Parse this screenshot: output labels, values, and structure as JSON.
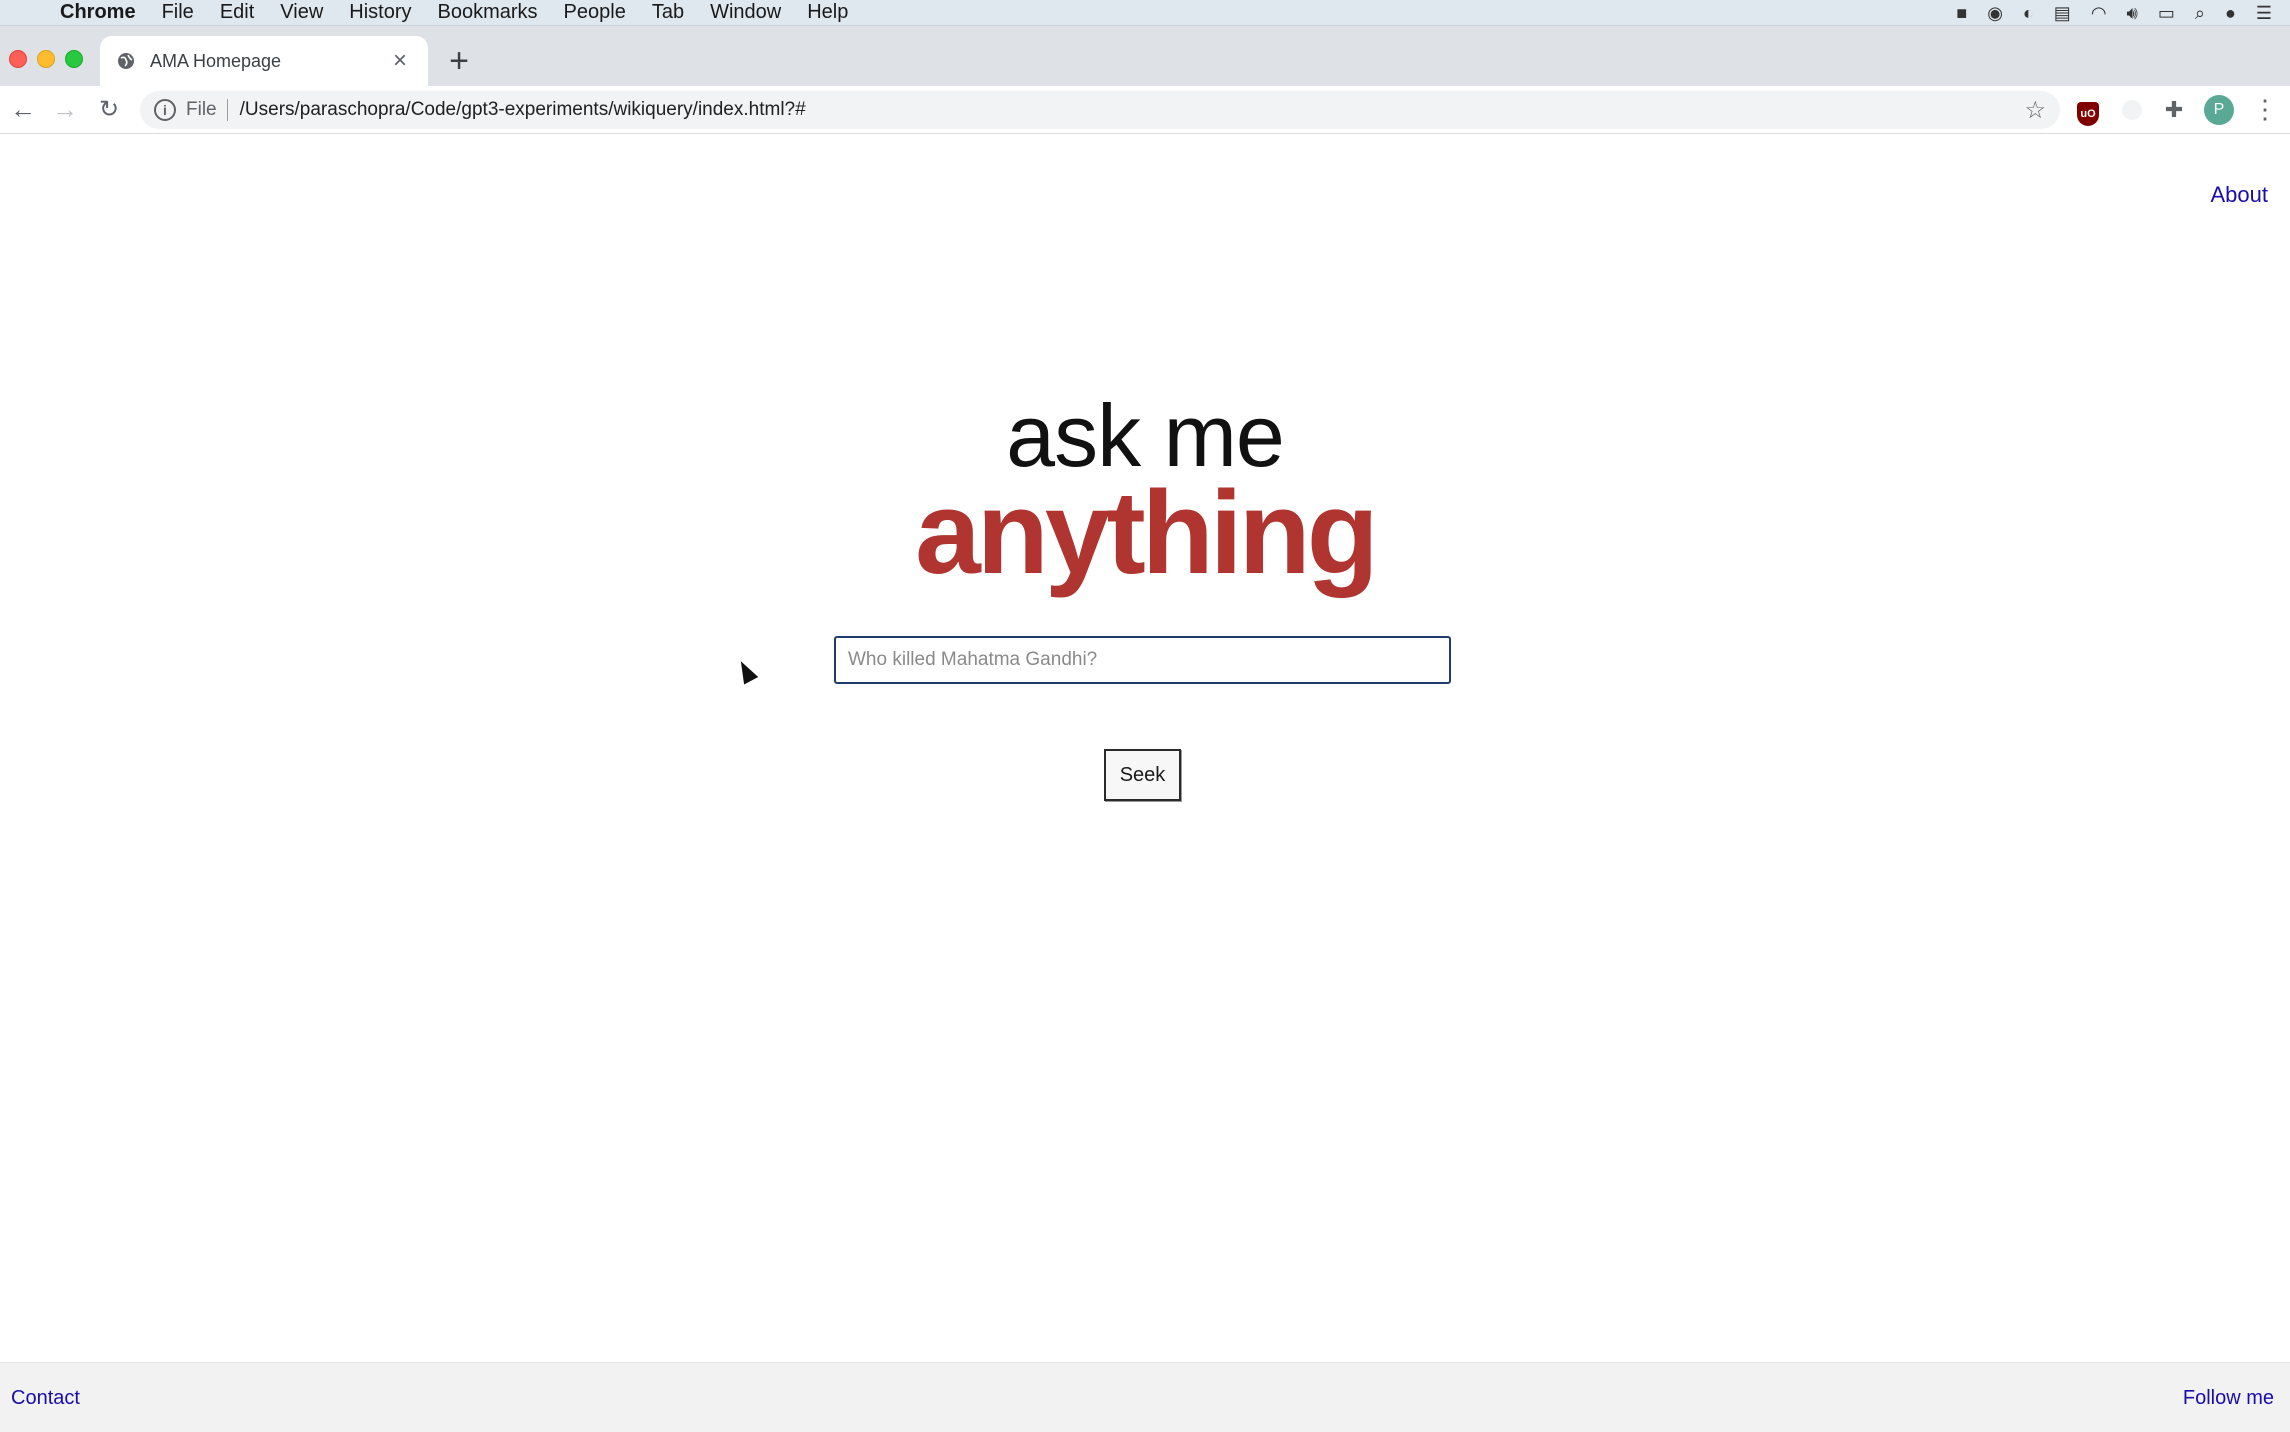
{
  "menubar": {
    "app_name": "Chrome",
    "items": [
      "File",
      "Edit",
      "View",
      "History",
      "Bookmarks",
      "People",
      "Tab",
      "Window",
      "Help"
    ]
  },
  "browser": {
    "tab_title": "AMA Homepage",
    "address_scheme": "File",
    "address_url": "/Users/paraschopra/Code/gpt3-experiments/wikiquery/index.html?#",
    "profile_initial": "P"
  },
  "page": {
    "about_link": "About",
    "logo_line1": "ask me",
    "logo_line2": "anything",
    "search_placeholder": "Who killed Mahatma Gandhi?",
    "seek_label": "Seek",
    "footer_contact": "Contact",
    "footer_follow": "Follow me"
  },
  "colors": {
    "logo_accent": "#b03530",
    "link": "#1a0dab",
    "input_border": "#1f3c70"
  }
}
